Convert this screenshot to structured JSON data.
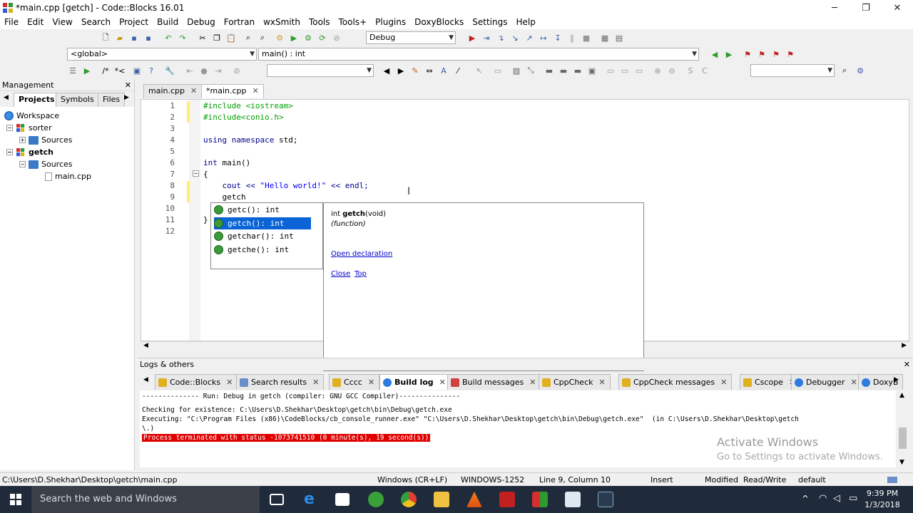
{
  "window": {
    "title": "*main.cpp [getch] - Code::Blocks 16.01",
    "minimize": "─",
    "maximize": "❐",
    "close": "✕"
  },
  "menu": [
    "File",
    "Edit",
    "View",
    "Search",
    "Project",
    "Build",
    "Debug",
    "Fortran",
    "wxSmith",
    "Tools",
    "Tools+",
    "Plugins",
    "DoxyBlocks",
    "Settings",
    "Help"
  ],
  "toolbar": {
    "build_target": "Debug",
    "scope": "<global>",
    "function": "main() : int"
  },
  "management": {
    "title": "Management",
    "tabs": [
      "Projects",
      "Symbols",
      "Files"
    ],
    "tree": [
      {
        "label": "Workspace",
        "bold": false
      },
      {
        "label": "sorter",
        "bold": false
      },
      {
        "label": "Sources",
        "bold": false
      },
      {
        "label": "getch",
        "bold": true
      },
      {
        "label": "Sources",
        "bold": false
      },
      {
        "label": "main.cpp",
        "bold": false
      }
    ]
  },
  "editor": {
    "tabs": [
      "main.cpp",
      "*main.cpp"
    ],
    "line_numbers": [
      "1",
      "2",
      "3",
      "4",
      "5",
      "6",
      "7",
      "8",
      "9",
      "10",
      "11",
      "12"
    ],
    "code": {
      "l1": "#include <iostream>",
      "l2": "#include<conio.h>",
      "l4_kw": "using namespace",
      "l4_rest": " std;",
      "l6_kw": "int",
      "l6_rest": " main()",
      "l7": "{",
      "l8_a": "    cout << ",
      "l8_str": "\"Hello world!\"",
      "l8_b": " << endl;",
      "l9": "    getch",
      "l11": "}"
    }
  },
  "autocomplete": {
    "items": [
      "getc(): int",
      "getch(): int",
      "getchar(): int",
      "getche(): int"
    ],
    "selected_index": 1,
    "doc_prefix": "int ",
    "doc_name": "getch",
    "doc_suffix": "(void)",
    "doc_kind": "(function)",
    "open_declaration": "Open declaration",
    "close": "Close",
    "top": "Top"
  },
  "logs": {
    "title": "Logs & others",
    "tabs": [
      "Code::Blocks",
      "Search results",
      "Cccc",
      "Build log",
      "Build messages",
      "CppCheck",
      "CppCheck messages",
      "Cscope",
      "Debugger",
      "DoxyB"
    ],
    "active_tab": "Build log",
    "lines": [
      "-------------- Run: Debug in getch (compiler: GNU GCC Compiler)---------------",
      "Checking for existence: C:\\Users\\D.Shekhar\\Desktop\\getch\\bin\\Debug\\getch.exe",
      "Executing: \"C:\\Program Files (x86)\\CodeBlocks/cb_console_runner.exe\" \"C:\\Users\\D.Shekhar\\Desktop\\getch\\bin\\Debug\\getch.exe\"  (in C:\\Users\\D.Shekhar\\Desktop\\getch",
      "\\.)",
      "Process terminated with status -1073741510 (0 minute(s), 19 second(s))"
    ],
    "watermark_title": "Activate Windows",
    "watermark_sub": "Go to Settings to activate Windows."
  },
  "statusbar": {
    "path": "C:\\Users\\D.Shekhar\\Desktop\\getch\\main.cpp",
    "eol": "Windows (CR+LF)",
    "encoding": "WINDOWS-1252",
    "position": "Line 9, Column 10",
    "mode": "Insert",
    "modified": "Modified",
    "access": "Read/Write",
    "profile": "default"
  },
  "taskbar": {
    "search_placeholder": "Search the web and Windows",
    "time": "9:39 PM",
    "date": "1/3/2018"
  },
  "colors": {
    "selection": "#0a64d6",
    "error_bg": "#e00000",
    "taskbar": "#1f2a3a"
  }
}
